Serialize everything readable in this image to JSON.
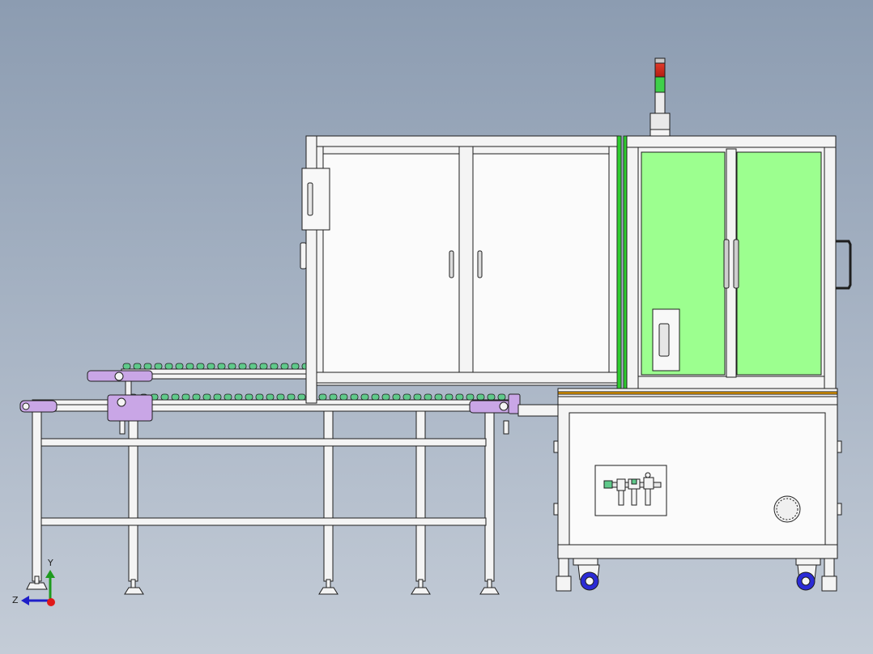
{
  "viewport": {
    "background_top": "#8c9cb1",
    "background_bottom": "#c4ccd7"
  },
  "colors": {
    "frame_fill": "#f4f4f4",
    "frame_stroke": "#1e1e1e",
    "glass_green": "#9cff8f",
    "accent_green": "#2ecc2e",
    "bracket_lavender": "#c9a6e6",
    "roller_green": "#5fc98a",
    "caster_blue": "#2b2bd6",
    "edge_orange": "#f0a000",
    "light_red": "#e03a2a",
    "light_green": "#3fd04a"
  },
  "triad": {
    "y_label": "Y",
    "z_label": "Z"
  }
}
